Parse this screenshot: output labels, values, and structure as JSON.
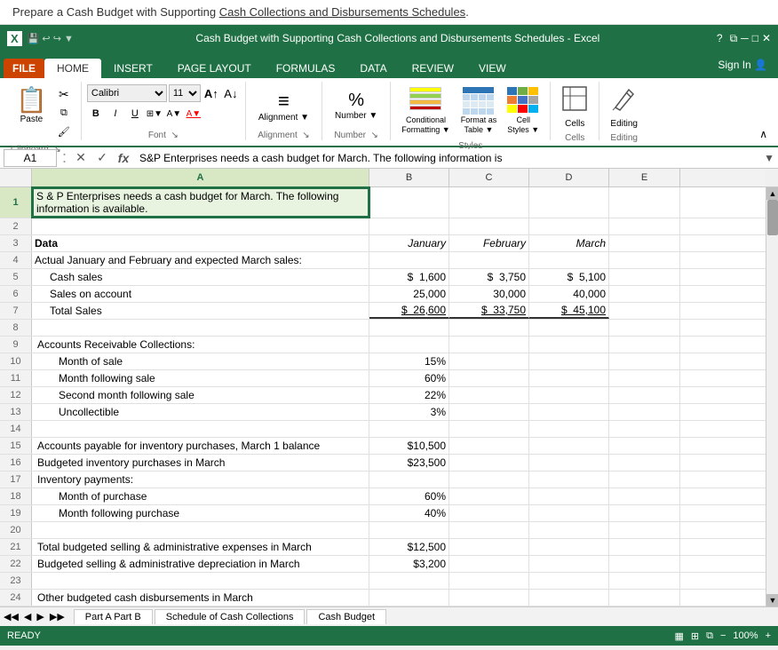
{
  "instruction": {
    "text": "Prepare a Cash Budget with Supporting Cash Collections and Disbursements Schedules."
  },
  "titlebar": {
    "title": "Cash Budget with Supporting Cash Collections and Disbursements Schedules - Excel",
    "help_icon": "?",
    "restore_icon": "⧉",
    "minimize_icon": "─",
    "maximize_icon": "□",
    "close_icon": "✕",
    "excel_icon": "X"
  },
  "ribbon": {
    "tabs": [
      "FILE",
      "HOME",
      "INSERT",
      "PAGE LAYOUT",
      "FORMULAS",
      "DATA",
      "REVIEW",
      "VIEW"
    ],
    "active_tab": "HOME",
    "sign_in": "Sign In",
    "groups": {
      "clipboard": {
        "label": "Clipboard",
        "paste": "Paste"
      },
      "font": {
        "label": "Font",
        "font_name": "Calibri",
        "font_size": "11"
      },
      "alignment": {
        "label": "Alignment",
        "button": "Alignment"
      },
      "number": {
        "label": "Number",
        "button": "Number"
      },
      "styles": {
        "label": "Styles",
        "conditional": "Conditional\nFormatting",
        "format_as_table": "Format as\nTable",
        "cell_styles": "Cell\nStyles"
      },
      "cells": {
        "label": "Cells",
        "button": "Cells"
      },
      "editing": {
        "label": "Editing",
        "button": "Editing"
      }
    }
  },
  "formula_bar": {
    "cell_ref": "A1",
    "formula": "S&P Enterprises needs a cash budget for March. The following information is"
  },
  "columns": {
    "headers": [
      "A",
      "B",
      "C",
      "D",
      "E"
    ],
    "widths": [
      380,
      90,
      90,
      90,
      80
    ]
  },
  "rows": [
    {
      "num": "1",
      "cells": [
        {
          "col": "a",
          "text": "S & P Enterprises needs a cash budget for March. The following information is available.",
          "style": "selected"
        },
        {
          "col": "b",
          "text": ""
        },
        {
          "col": "c",
          "text": ""
        },
        {
          "col": "d",
          "text": ""
        },
        {
          "col": "e",
          "text": ""
        }
      ]
    },
    {
      "num": "2",
      "cells": [
        {
          "col": "a",
          "text": ""
        },
        {
          "col": "b",
          "text": ""
        },
        {
          "col": "c",
          "text": ""
        },
        {
          "col": "d",
          "text": ""
        },
        {
          "col": "e",
          "text": ""
        }
      ]
    },
    {
      "num": "3",
      "cells": [
        {
          "col": "a",
          "text": "Data",
          "bold": true
        },
        {
          "col": "b",
          "text": "January",
          "italic": true,
          "right": true
        },
        {
          "col": "c",
          "text": "February",
          "italic": true,
          "right": true
        },
        {
          "col": "d",
          "text": "March",
          "italic": true,
          "right": true
        },
        {
          "col": "e",
          "text": ""
        }
      ]
    },
    {
      "num": "4",
      "cells": [
        {
          "col": "a",
          "text": "Actual January and February and expected March sales:"
        },
        {
          "col": "b",
          "text": ""
        },
        {
          "col": "c",
          "text": ""
        },
        {
          "col": "d",
          "text": ""
        },
        {
          "col": "e",
          "text": ""
        }
      ]
    },
    {
      "num": "5",
      "cells": [
        {
          "col": "a",
          "text": "   Cash sales",
          "indent": true
        },
        {
          "col": "b",
          "text": "$  1,600",
          "right": true
        },
        {
          "col": "c",
          "text": "$  3,750",
          "right": true
        },
        {
          "col": "d",
          "text": "$  5,100",
          "right": true
        },
        {
          "col": "e",
          "text": ""
        }
      ]
    },
    {
      "num": "6",
      "cells": [
        {
          "col": "a",
          "text": "   Sales on account",
          "indent": true
        },
        {
          "col": "b",
          "text": "25,000",
          "right": true
        },
        {
          "col": "c",
          "text": "30,000",
          "right": true
        },
        {
          "col": "d",
          "text": "40,000",
          "right": true
        },
        {
          "col": "e",
          "text": ""
        }
      ]
    },
    {
      "num": "7",
      "cells": [
        {
          "col": "a",
          "text": "   Total Sales",
          "indent": true
        },
        {
          "col": "b",
          "text": "$  26,600",
          "right": true,
          "underline": true
        },
        {
          "col": "c",
          "text": "$  33,750",
          "right": true,
          "underline": true
        },
        {
          "col": "d",
          "text": "$  45,100",
          "right": true,
          "underline": true
        },
        {
          "col": "e",
          "text": ""
        }
      ]
    },
    {
      "num": "8",
      "cells": [
        {
          "col": "a",
          "text": ""
        },
        {
          "col": "b",
          "text": ""
        },
        {
          "col": "c",
          "text": ""
        },
        {
          "col": "d",
          "text": ""
        },
        {
          "col": "e",
          "text": ""
        }
      ]
    },
    {
      "num": "9",
      "cells": [
        {
          "col": "a",
          "text": "   Accounts Receivable Collections:"
        },
        {
          "col": "b",
          "text": ""
        },
        {
          "col": "c",
          "text": ""
        },
        {
          "col": "d",
          "text": ""
        },
        {
          "col": "e",
          "text": ""
        }
      ]
    },
    {
      "num": "10",
      "cells": [
        {
          "col": "a",
          "text": "      Month of sale",
          "indent2": true
        },
        {
          "col": "b",
          "text": "15%",
          "right": true
        },
        {
          "col": "c",
          "text": ""
        },
        {
          "col": "d",
          "text": ""
        },
        {
          "col": "e",
          "text": ""
        }
      ]
    },
    {
      "num": "11",
      "cells": [
        {
          "col": "a",
          "text": "      Month following sale",
          "indent2": true
        },
        {
          "col": "b",
          "text": "60%",
          "right": true
        },
        {
          "col": "c",
          "text": ""
        },
        {
          "col": "d",
          "text": ""
        },
        {
          "col": "e",
          "text": ""
        }
      ]
    },
    {
      "num": "12",
      "cells": [
        {
          "col": "a",
          "text": "      Second month following sale",
          "indent2": true
        },
        {
          "col": "b",
          "text": "22%",
          "right": true
        },
        {
          "col": "c",
          "text": ""
        },
        {
          "col": "d",
          "text": ""
        },
        {
          "col": "e",
          "text": ""
        }
      ]
    },
    {
      "num": "13",
      "cells": [
        {
          "col": "a",
          "text": "      Uncollectible",
          "indent2": true
        },
        {
          "col": "b",
          "text": "3%",
          "right": true
        },
        {
          "col": "c",
          "text": ""
        },
        {
          "col": "d",
          "text": ""
        },
        {
          "col": "e",
          "text": ""
        }
      ]
    },
    {
      "num": "14",
      "cells": [
        {
          "col": "a",
          "text": ""
        },
        {
          "col": "b",
          "text": ""
        },
        {
          "col": "c",
          "text": ""
        },
        {
          "col": "d",
          "text": ""
        },
        {
          "col": "e",
          "text": ""
        }
      ]
    },
    {
      "num": "15",
      "cells": [
        {
          "col": "a",
          "text": "   Accounts payable for inventory purchases, March 1 balance"
        },
        {
          "col": "b",
          "text": "$10,500",
          "right": true
        },
        {
          "col": "c",
          "text": ""
        },
        {
          "col": "d",
          "text": ""
        },
        {
          "col": "e",
          "text": ""
        }
      ]
    },
    {
      "num": "16",
      "cells": [
        {
          "col": "a",
          "text": "   Budgeted inventory purchases in March"
        },
        {
          "col": "b",
          "text": "$23,500",
          "right": true
        },
        {
          "col": "c",
          "text": ""
        },
        {
          "col": "d",
          "text": ""
        },
        {
          "col": "e",
          "text": ""
        }
      ]
    },
    {
      "num": "17",
      "cells": [
        {
          "col": "a",
          "text": "   Inventory payments:"
        },
        {
          "col": "b",
          "text": ""
        },
        {
          "col": "c",
          "text": ""
        },
        {
          "col": "d",
          "text": ""
        },
        {
          "col": "e",
          "text": ""
        }
      ]
    },
    {
      "num": "18",
      "cells": [
        {
          "col": "a",
          "text": "      Month of purchase",
          "indent2": true
        },
        {
          "col": "b",
          "text": "60%",
          "right": true
        },
        {
          "col": "c",
          "text": ""
        },
        {
          "col": "d",
          "text": ""
        },
        {
          "col": "e",
          "text": ""
        }
      ]
    },
    {
      "num": "19",
      "cells": [
        {
          "col": "a",
          "text": "      Month following purchase",
          "indent2": true
        },
        {
          "col": "b",
          "text": "40%",
          "right": true
        },
        {
          "col": "c",
          "text": ""
        },
        {
          "col": "d",
          "text": ""
        },
        {
          "col": "e",
          "text": ""
        }
      ]
    },
    {
      "num": "20",
      "cells": [
        {
          "col": "a",
          "text": ""
        },
        {
          "col": "b",
          "text": ""
        },
        {
          "col": "c",
          "text": ""
        },
        {
          "col": "d",
          "text": ""
        },
        {
          "col": "e",
          "text": ""
        }
      ]
    },
    {
      "num": "21",
      "cells": [
        {
          "col": "a",
          "text": "   Total budgeted selling & administrative expenses in March"
        },
        {
          "col": "b",
          "text": "$12,500",
          "right": true
        },
        {
          "col": "c",
          "text": ""
        },
        {
          "col": "d",
          "text": ""
        },
        {
          "col": "e",
          "text": ""
        }
      ]
    },
    {
      "num": "22",
      "cells": [
        {
          "col": "a",
          "text": "   Budgeted selling & administrative depreciation in March"
        },
        {
          "col": "b",
          "text": "$3,200",
          "right": true
        },
        {
          "col": "c",
          "text": ""
        },
        {
          "col": "d",
          "text": ""
        },
        {
          "col": "e",
          "text": ""
        }
      ]
    },
    {
      "num": "23",
      "cells": [
        {
          "col": "a",
          "text": ""
        },
        {
          "col": "b",
          "text": ""
        },
        {
          "col": "c",
          "text": ""
        },
        {
          "col": "d",
          "text": ""
        },
        {
          "col": "e",
          "text": ""
        }
      ]
    },
    {
      "num": "24",
      "cells": [
        {
          "col": "a",
          "text": "   Other budgeted cash disbursements in March"
        },
        {
          "col": "b",
          "text": ""
        },
        {
          "col": "c",
          "text": ""
        },
        {
          "col": "d",
          "text": ""
        },
        {
          "col": "e",
          "text": ""
        }
      ]
    }
  ],
  "sheet_tabs": [
    {
      "label": "Part A Part B",
      "active": false
    },
    {
      "label": "Schedule of Cash Collections",
      "active": false
    },
    {
      "label": "Cash Budget",
      "active": false
    }
  ],
  "status_bar": {
    "ready": "READY"
  }
}
